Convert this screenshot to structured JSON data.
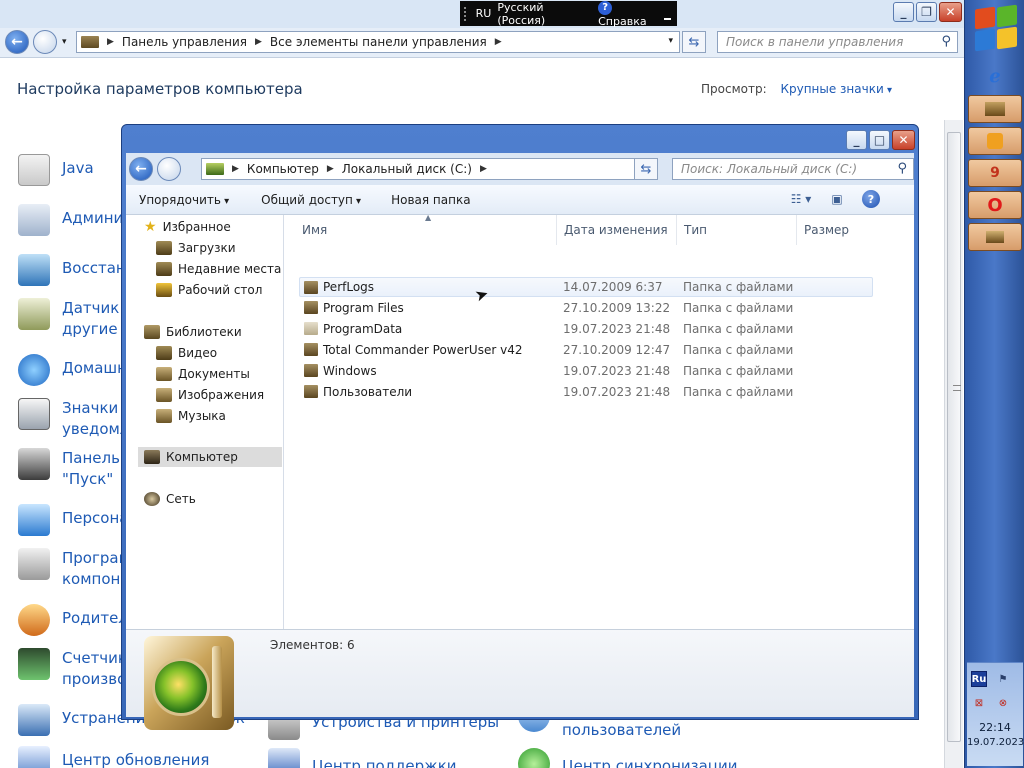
{
  "langbar": {
    "lang": "RU",
    "lang_name": "Русский (Россия)",
    "help": "Справка"
  },
  "control_panel": {
    "address": [
      "Панель управления",
      "Все элементы панели управления"
    ],
    "search_placeholder": "Поиск в панели управления",
    "heading": "Настройка параметров компьютера",
    "view_label": "Просмотр:",
    "view_value": "Крупные значки",
    "items": [
      {
        "label": "Java",
        "label2": ""
      },
      {
        "label": "Админи",
        "label2": ""
      },
      {
        "label": "Восстано",
        "label2": ""
      },
      {
        "label": "Датчик р",
        "label2": "другие д"
      },
      {
        "label": "Домашн",
        "label2": ""
      },
      {
        "label": "Значки о",
        "label2": "уведомл"
      },
      {
        "label": "Панель з",
        "label2": "\"Пуск\""
      },
      {
        "label": "Персона",
        "label2": ""
      },
      {
        "label": "Програм",
        "label2": "компоне"
      },
      {
        "label": "Родител",
        "label2": ""
      },
      {
        "label": "Счетчик",
        "label2": "произво"
      },
      {
        "label": "Устранение неполадок",
        "label2": ""
      },
      {
        "label": "Центр обновления",
        "label2": ""
      }
    ],
    "bottom_items": [
      "Устройства и принтеры",
      "пользователей",
      "Центр поддержки",
      "Центр синхронизации"
    ]
  },
  "explorer": {
    "address": [
      "Компьютер",
      "Локальный диск (C:)"
    ],
    "search_placeholder": "Поиск: Локальный диск (C:)",
    "toolbar": {
      "organize": "Упорядочить",
      "share": "Общий доступ",
      "new_folder": "Новая папка"
    },
    "nav": {
      "favorites": "Избранное",
      "downloads": "Загрузки",
      "recent": "Недавние места",
      "desktop": "Рабочий стол",
      "libraries": "Библиотеки",
      "video": "Видео",
      "documents": "Документы",
      "images": "Изображения",
      "music": "Музыка",
      "computer": "Компьютер",
      "network": "Сеть"
    },
    "columns": {
      "name": "Имя",
      "date": "Дата изменения",
      "type": "Тип",
      "size": "Размер"
    },
    "files": [
      {
        "name": "PerfLogs",
        "date": "14.07.2009 6:37",
        "type": "Папка с файлами"
      },
      {
        "name": "Program Files",
        "date": "27.10.2009 13:22",
        "type": "Папка с файлами"
      },
      {
        "name": "ProgramData",
        "date": "19.07.2023 21:48",
        "type": "Папка с файлами"
      },
      {
        "name": "Total Commander PowerUser v42",
        "date": "27.10.2009 12:47",
        "type": "Папка с файлами"
      },
      {
        "name": "Windows",
        "date": "19.07.2023 21:48",
        "type": "Папка с файлами"
      },
      {
        "name": "Пользователи",
        "date": "19.07.2023 21:48",
        "type": "Папка с файлами"
      }
    ],
    "details": {
      "count": "Элементов: 6"
    }
  },
  "tray": {
    "lang": "Ru",
    "time": "22:14",
    "date": "19.07.2023"
  },
  "colors": {
    "accent": "#1e5ab4",
    "title_bar": "#3867b8",
    "taskbar": "#4a78c8"
  }
}
